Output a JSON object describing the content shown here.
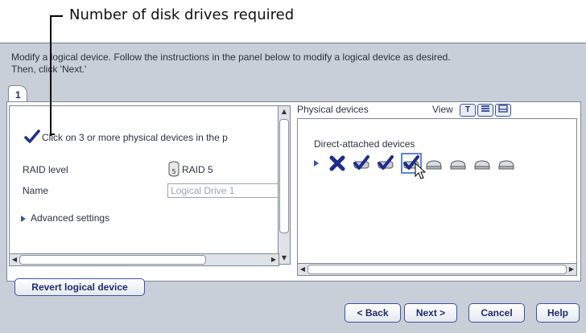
{
  "callout": {
    "text": "Number of disk drives required"
  },
  "instructions": {
    "line1": "Modify a logical device.  Follow the instructions in the panel below to modify a logical device as desired.",
    "line2": "Then, click 'Next.'"
  },
  "tabs": [
    {
      "label": "1"
    }
  ],
  "left_panel": {
    "instruction": "Click on 3 or more physical devices in the p",
    "fields": {
      "raid_label": "RAID level",
      "raid_icon_text": "5",
      "raid_value": "RAID 5",
      "name_label": "Name",
      "name_value": "Logical Drive 1"
    },
    "advanced": "Advanced settings"
  },
  "right_panel": {
    "title": "Physical devices",
    "view_label": "View",
    "view_buttons": [
      "T",
      "",
      ""
    ],
    "group_label": "Direct-attached devices",
    "devices": [
      {
        "state": "unavailable",
        "icon": "x-disk-icon"
      },
      {
        "state": "selected",
        "icon": "checked-disk-icon"
      },
      {
        "state": "selected",
        "icon": "checked-disk-icon"
      },
      {
        "state": "selected-focused",
        "icon": "checked-disk-icon"
      },
      {
        "state": "available",
        "icon": "disk-icon"
      },
      {
        "state": "available",
        "icon": "disk-icon"
      },
      {
        "state": "available",
        "icon": "disk-icon"
      },
      {
        "state": "available",
        "icon": "disk-icon"
      }
    ]
  },
  "buttons": {
    "revert": "Revert logical device",
    "back": "< Back",
    "next": "Next >",
    "cancel": "Cancel",
    "help": "Help"
  },
  "colors": {
    "accent": "#3a55a0",
    "check": "#1e2d8c",
    "background": "#c8cfd8"
  }
}
